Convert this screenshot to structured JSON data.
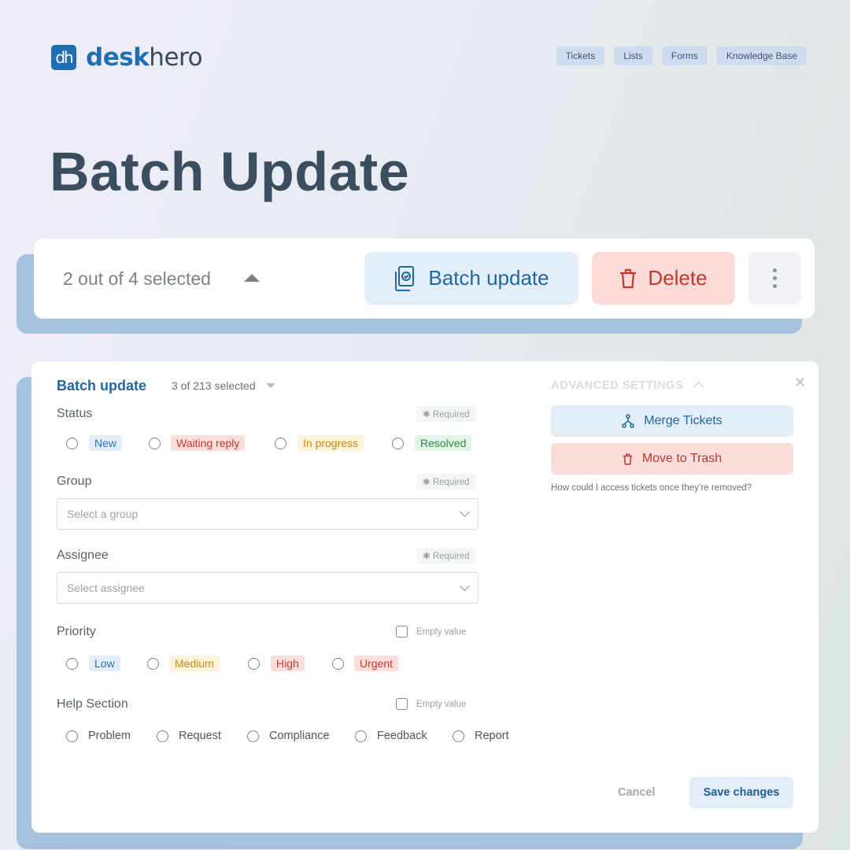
{
  "brand": {
    "mark": "dh",
    "name_bold": "desk",
    "name_light": "hero"
  },
  "nav": [
    "Tickets",
    "Lists",
    "Forms",
    "Knowledge Base"
  ],
  "hero_title": "Batch Update",
  "topbar": {
    "selection_text": "2 out of 4 selected",
    "batch_label": "Batch update",
    "delete_label": "Delete"
  },
  "panel": {
    "title": "Batch update",
    "count": "3 of 213 selected",
    "required_label": "✱ Required",
    "empty_value_label": "Empty value",
    "status": {
      "label": "Status",
      "options": [
        "New",
        "Waiting reply",
        "In progress",
        "Resolved"
      ]
    },
    "group": {
      "label": "Group",
      "placeholder": "Select a group"
    },
    "assignee": {
      "label": "Assignee",
      "placeholder": "Select assignee"
    },
    "priority": {
      "label": "Priority",
      "options": [
        "Low",
        "Medium",
        "High",
        "Urgent"
      ]
    },
    "help_section": {
      "label": "Help Section",
      "options": [
        "Problem",
        "Request",
        "Compliance",
        "Feedback",
        "Report"
      ]
    },
    "advanced": {
      "title": "ADVANCED SETTINGS",
      "merge_label": "Merge Tickets",
      "trash_label": "Move to Trash",
      "help_text": "How could I access tickets once they’re removed?"
    },
    "cancel_label": "Cancel",
    "save_label": "Save changes"
  },
  "colors": {
    "accent": "#1f6fb2",
    "danger": "#c0392b",
    "shadow": "#a6c1de"
  }
}
